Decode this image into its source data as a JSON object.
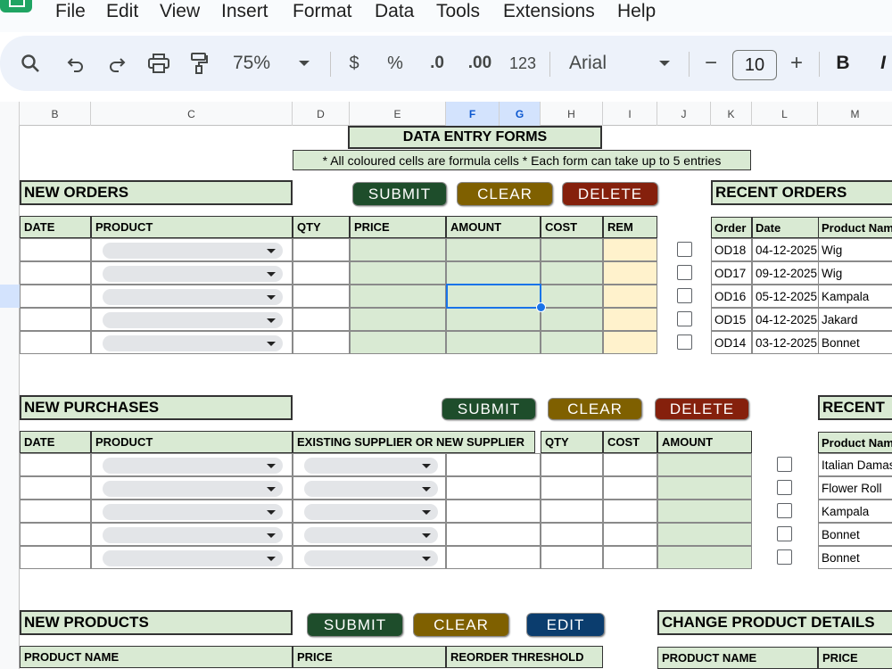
{
  "menu": [
    "File",
    "Edit",
    "View",
    "Insert",
    "Format",
    "Data",
    "Tools",
    "Extensions",
    "Help"
  ],
  "toolbar": {
    "zoom": "75%",
    "currency": "$",
    "percent": "%",
    "decrease_decimal": ".0",
    "increase_decimal": ".00",
    "number_format": "123",
    "font": "Arial",
    "font_size": "10",
    "minus": "−",
    "plus": "+",
    "bold": "B",
    "italic": "I"
  },
  "columns": [
    "B",
    "C",
    "D",
    "E",
    "F",
    "G",
    "H",
    "I",
    "J",
    "K",
    "L",
    "M"
  ],
  "title": "DATA ENTRY FORMS",
  "note": "* All coloured cells are formula cells  * Each form can take up to 5 entries",
  "buttons": {
    "submit": "SUBMIT",
    "clear": "CLEAR",
    "delete": "DELETE",
    "edit": "EDIT"
  },
  "orders": {
    "title": "NEW ORDERS",
    "headers": [
      "DATE",
      "PRODUCT",
      "QTY",
      "PRICE",
      "AMOUNT",
      "COST",
      "REM"
    ]
  },
  "recent_orders": {
    "title": "RECENT ORDERS",
    "headers": [
      "Order",
      "Date",
      "Product Nam"
    ],
    "rows": [
      [
        "OD18",
        "04-12-2025",
        "Wig"
      ],
      [
        "OD17",
        "09-12-2025",
        "Wig"
      ],
      [
        "OD16",
        "05-12-2025",
        "Kampala"
      ],
      [
        "OD15",
        "04-12-2025",
        "Jakard"
      ],
      [
        "OD14",
        "03-12-2025",
        "Bonnet"
      ]
    ]
  },
  "purchases": {
    "title": "NEW PURCHASES",
    "headers": [
      "DATE",
      "PRODUCT",
      "EXISTING SUPPLIER OR NEW SUPPLIER",
      "QTY",
      "COST",
      "AMOUNT"
    ]
  },
  "recent_purchases": {
    "title": "RECENT",
    "header": "Product Nam",
    "rows": [
      "Italian Damas",
      "Flower Roll",
      "Kampala",
      "Bonnet",
      "Bonnet"
    ]
  },
  "products": {
    "title": "NEW PRODUCTS",
    "headers": [
      "PRODUCT NAME",
      "PRICE",
      "REORDER THRESHOLD"
    ]
  },
  "change_products": {
    "title": "CHANGE PRODUCT DETAILS",
    "headers": [
      "PRODUCT NAME",
      "PRICE"
    ]
  }
}
